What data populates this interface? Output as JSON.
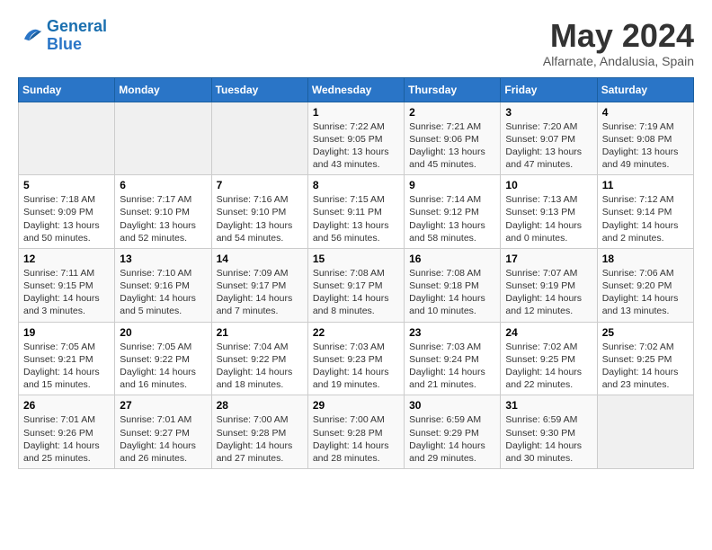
{
  "logo": {
    "text_general": "General",
    "text_blue": "Blue"
  },
  "title": "May 2024",
  "location": "Alfarnate, Andalusia, Spain",
  "weekdays": [
    "Sunday",
    "Monday",
    "Tuesday",
    "Wednesday",
    "Thursday",
    "Friday",
    "Saturday"
  ],
  "weeks": [
    [
      {
        "day": "",
        "info": ""
      },
      {
        "day": "",
        "info": ""
      },
      {
        "day": "",
        "info": ""
      },
      {
        "day": "1",
        "info": "Sunrise: 7:22 AM\nSunset: 9:05 PM\nDaylight: 13 hours\nand 43 minutes."
      },
      {
        "day": "2",
        "info": "Sunrise: 7:21 AM\nSunset: 9:06 PM\nDaylight: 13 hours\nand 45 minutes."
      },
      {
        "day": "3",
        "info": "Sunrise: 7:20 AM\nSunset: 9:07 PM\nDaylight: 13 hours\nand 47 minutes."
      },
      {
        "day": "4",
        "info": "Sunrise: 7:19 AM\nSunset: 9:08 PM\nDaylight: 13 hours\nand 49 minutes."
      }
    ],
    [
      {
        "day": "5",
        "info": "Sunrise: 7:18 AM\nSunset: 9:09 PM\nDaylight: 13 hours\nand 50 minutes."
      },
      {
        "day": "6",
        "info": "Sunrise: 7:17 AM\nSunset: 9:10 PM\nDaylight: 13 hours\nand 52 minutes."
      },
      {
        "day": "7",
        "info": "Sunrise: 7:16 AM\nSunset: 9:10 PM\nDaylight: 13 hours\nand 54 minutes."
      },
      {
        "day": "8",
        "info": "Sunrise: 7:15 AM\nSunset: 9:11 PM\nDaylight: 13 hours\nand 56 minutes."
      },
      {
        "day": "9",
        "info": "Sunrise: 7:14 AM\nSunset: 9:12 PM\nDaylight: 13 hours\nand 58 minutes."
      },
      {
        "day": "10",
        "info": "Sunrise: 7:13 AM\nSunset: 9:13 PM\nDaylight: 14 hours\nand 0 minutes."
      },
      {
        "day": "11",
        "info": "Sunrise: 7:12 AM\nSunset: 9:14 PM\nDaylight: 14 hours\nand 2 minutes."
      }
    ],
    [
      {
        "day": "12",
        "info": "Sunrise: 7:11 AM\nSunset: 9:15 PM\nDaylight: 14 hours\nand 3 minutes."
      },
      {
        "day": "13",
        "info": "Sunrise: 7:10 AM\nSunset: 9:16 PM\nDaylight: 14 hours\nand 5 minutes."
      },
      {
        "day": "14",
        "info": "Sunrise: 7:09 AM\nSunset: 9:17 PM\nDaylight: 14 hours\nand 7 minutes."
      },
      {
        "day": "15",
        "info": "Sunrise: 7:08 AM\nSunset: 9:17 PM\nDaylight: 14 hours\nand 8 minutes."
      },
      {
        "day": "16",
        "info": "Sunrise: 7:08 AM\nSunset: 9:18 PM\nDaylight: 14 hours\nand 10 minutes."
      },
      {
        "day": "17",
        "info": "Sunrise: 7:07 AM\nSunset: 9:19 PM\nDaylight: 14 hours\nand 12 minutes."
      },
      {
        "day": "18",
        "info": "Sunrise: 7:06 AM\nSunset: 9:20 PM\nDaylight: 14 hours\nand 13 minutes."
      }
    ],
    [
      {
        "day": "19",
        "info": "Sunrise: 7:05 AM\nSunset: 9:21 PM\nDaylight: 14 hours\nand 15 minutes."
      },
      {
        "day": "20",
        "info": "Sunrise: 7:05 AM\nSunset: 9:22 PM\nDaylight: 14 hours\nand 16 minutes."
      },
      {
        "day": "21",
        "info": "Sunrise: 7:04 AM\nSunset: 9:22 PM\nDaylight: 14 hours\nand 18 minutes."
      },
      {
        "day": "22",
        "info": "Sunrise: 7:03 AM\nSunset: 9:23 PM\nDaylight: 14 hours\nand 19 minutes."
      },
      {
        "day": "23",
        "info": "Sunrise: 7:03 AM\nSunset: 9:24 PM\nDaylight: 14 hours\nand 21 minutes."
      },
      {
        "day": "24",
        "info": "Sunrise: 7:02 AM\nSunset: 9:25 PM\nDaylight: 14 hours\nand 22 minutes."
      },
      {
        "day": "25",
        "info": "Sunrise: 7:02 AM\nSunset: 9:25 PM\nDaylight: 14 hours\nand 23 minutes."
      }
    ],
    [
      {
        "day": "26",
        "info": "Sunrise: 7:01 AM\nSunset: 9:26 PM\nDaylight: 14 hours\nand 25 minutes."
      },
      {
        "day": "27",
        "info": "Sunrise: 7:01 AM\nSunset: 9:27 PM\nDaylight: 14 hours\nand 26 minutes."
      },
      {
        "day": "28",
        "info": "Sunrise: 7:00 AM\nSunset: 9:28 PM\nDaylight: 14 hours\nand 27 minutes."
      },
      {
        "day": "29",
        "info": "Sunrise: 7:00 AM\nSunset: 9:28 PM\nDaylight: 14 hours\nand 28 minutes."
      },
      {
        "day": "30",
        "info": "Sunrise: 6:59 AM\nSunset: 9:29 PM\nDaylight: 14 hours\nand 29 minutes."
      },
      {
        "day": "31",
        "info": "Sunrise: 6:59 AM\nSunset: 9:30 PM\nDaylight: 14 hours\nand 30 minutes."
      },
      {
        "day": "",
        "info": ""
      }
    ]
  ]
}
